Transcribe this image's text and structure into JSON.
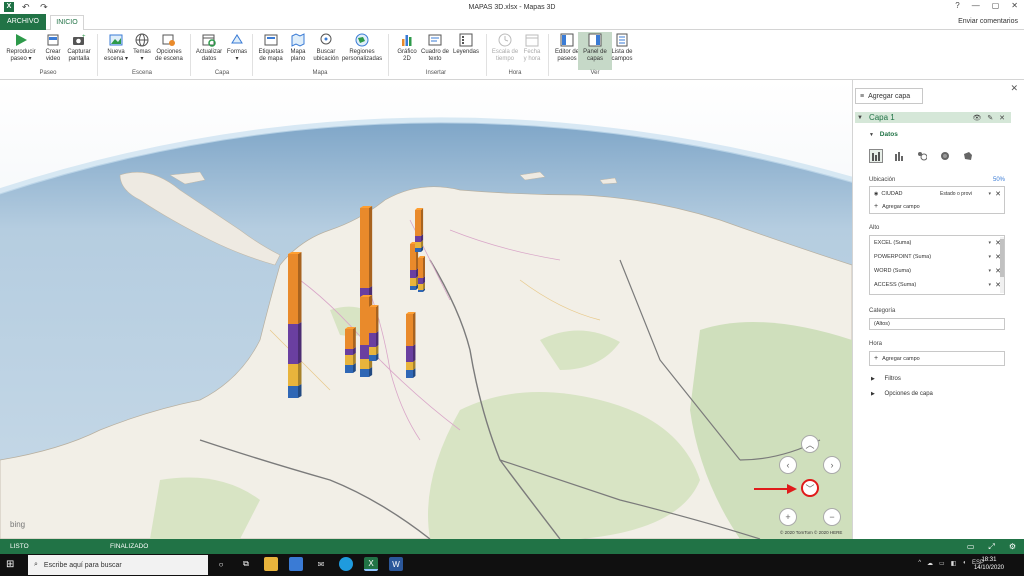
{
  "window": {
    "title": "MAPAS 3D.xlsx - Mapas 3D",
    "app_icon": "X",
    "controls": [
      "?",
      "—",
      "▢",
      "✕"
    ]
  },
  "tabs": {
    "archivo": "ARCHIVO",
    "inicio": "INICIO",
    "feedback": "Enviar comentarios"
  },
  "ribbon": {
    "buttons": {
      "play": "Reproducir\npaseo ▾",
      "video": "Crear\nvideo",
      "capture": "Capturar\npantalla",
      "new_scene": "Nueva\nescena ▾",
      "themes": "Temas\n▾",
      "scene_options": "Opciones\nde escena",
      "refresh": "Actualizar\ndatos",
      "shapes": "Formas\n▾",
      "map_labels": "Etiquetas\nde mapa",
      "flat_map": "Mapa\nplano",
      "find_location": "Buscar\nubicación",
      "custom_regions": "Regiones\npersonalizadas",
      "chart_2d": "Gráfico\n2D",
      "text_box": "Cuadro de\ntexto",
      "legends": "Leyendas",
      "time_scale": "Escala de\ntiempo",
      "date_time": "Fecha\ny hora",
      "tour_editor": "Editor de\npaseos",
      "layer_pane": "Panel de\ncapas",
      "field_list": "Lista de\ncampos"
    },
    "groups": {
      "tour": "Paseo",
      "scene": "Escena",
      "layer": "Capa",
      "map": "Mapa",
      "insert": "Insertar",
      "time": "Hora",
      "view": "Ver"
    }
  },
  "map": {
    "provider": "bing",
    "copyright": "© 2020 TomTom © 2020 HERE"
  },
  "pane": {
    "add_layer": "Agregar capa",
    "layer_name": "Capa 1",
    "layer_tools": "👁 ✎ ✕",
    "data_section": "Datos",
    "location": {
      "label": "Ubicación",
      "confidence": "50%",
      "field": "CIUDAD",
      "field_type": "Estado o provi",
      "add_field": "Agregar campo"
    },
    "height": {
      "label": "Alto",
      "fields": [
        "EXCEL (Suma)",
        "POWERPOINT (Suma)",
        "WORD (Suma)",
        "ACCESS (Suma)"
      ]
    },
    "category": {
      "label": "Categoría",
      "value": "(Altos)"
    },
    "time": {
      "label": "Hora",
      "add_field": "Agregar campo"
    },
    "filters": "Filtros",
    "layer_options": "Opciones de capa"
  },
  "status": {
    "ready": "LISTO",
    "finished": "FINALIZADO"
  },
  "taskbar": {
    "search_placeholder": "Escribe aquí para buscar",
    "language": "ESP",
    "time": "18:31",
    "date": "14/10/2020"
  },
  "colors": {
    "excel_green": "#217346",
    "bar_excel": "#e98a2b",
    "bar_powerpoint": "#6a3fa0",
    "bar_word": "#e8b43c",
    "bar_access": "#2f67b5",
    "annotation_red": "#e01b1b"
  }
}
